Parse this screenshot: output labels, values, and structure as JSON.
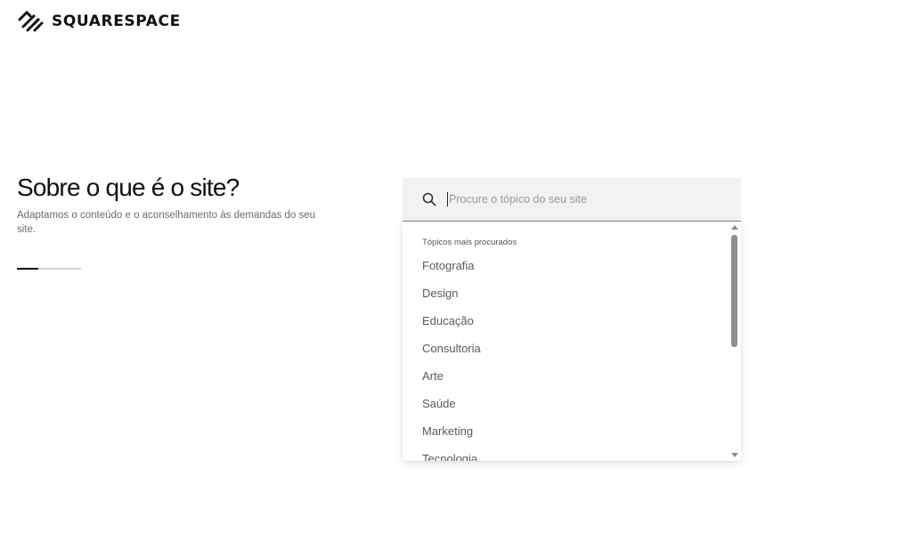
{
  "brand": {
    "name": "SQUARESPACE",
    "icon": "squarespace-logo-icon"
  },
  "main": {
    "heading": "Sobre o que é o site?",
    "subtitle": "Adaptamos o conteúdo e o aconselhamento às demandas do seu site.",
    "progress": {
      "current_step": 1,
      "total_steps": 3
    }
  },
  "search": {
    "icon": "search-icon",
    "placeholder": "Procure o tópico do seu site",
    "value": ""
  },
  "dropdown": {
    "heading": "Tópicos mais procurados",
    "items": [
      "Fotografia",
      "Design",
      "Educação",
      "Consultoria",
      "Arte",
      "Saúde",
      "Marketing",
      "Tecnologia"
    ]
  },
  "colors": {
    "text": "#111111",
    "muted": "#6b6b6b",
    "search_bg": "#f2f2f2",
    "item_text": "#5a5a5a"
  }
}
